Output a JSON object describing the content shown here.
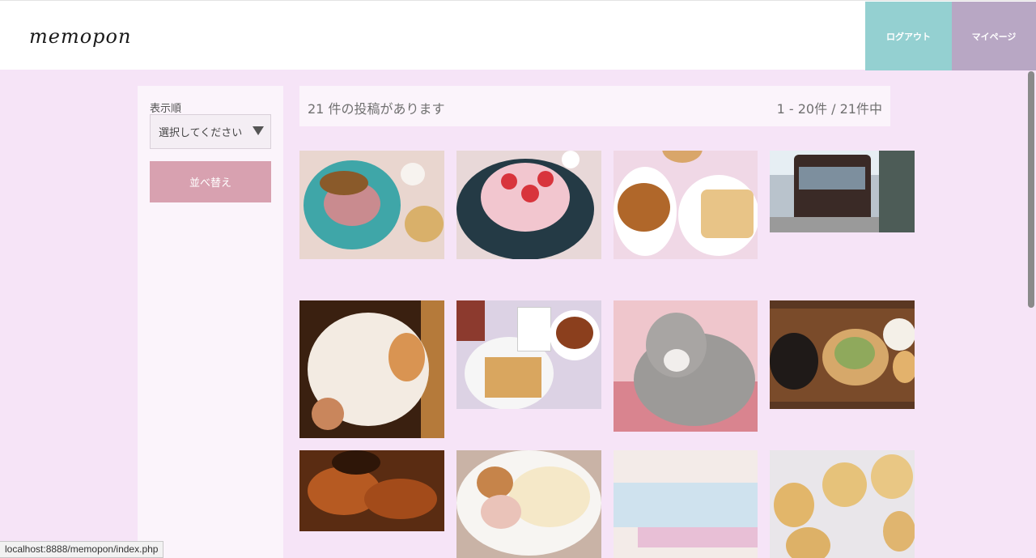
{
  "header": {
    "logo": "memopon",
    "logout_label": "ログアウト",
    "mypage_label": "マイページ",
    "logout_color": "#94d0d1",
    "mypage_color": "#b8a7c4"
  },
  "sidebar": {
    "sort_label": "表示順",
    "sort_select_value": "選択してください",
    "sort_button_label": "並べ替え",
    "sort_button_color": "#d8a1b0"
  },
  "main": {
    "count_text": "21 件の投稿があります",
    "page_range": "1 - 20件 / 21件中"
  },
  "posts": [
    {
      "name": "post-curry-plate"
    },
    {
      "name": "post-strawberry-cake"
    },
    {
      "name": "post-tea-cheesecake"
    },
    {
      "name": "post-retro-bus"
    },
    {
      "name": "post-sleeping-cat"
    },
    {
      "name": "post-panda-tea-set"
    },
    {
      "name": "post-gray-cat"
    },
    {
      "name": "post-hamburg-lunch"
    },
    {
      "name": "post-autumn-leaves"
    },
    {
      "name": "post-omurice"
    },
    {
      "name": "post-for-you-card"
    },
    {
      "name": "post-bear-cookies"
    }
  ],
  "status_bar": {
    "url": "localhost:8888/memopon/index.php"
  }
}
